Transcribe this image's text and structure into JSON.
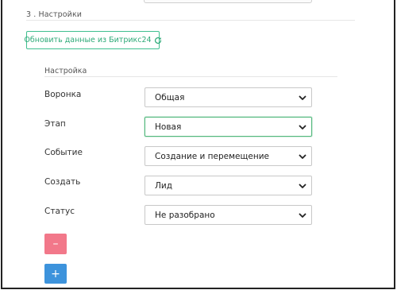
{
  "section": {
    "title": "3 . Настройки",
    "refresh_button": {
      "label": "Обновить данные из Битрикс24",
      "icon": "refresh-icon"
    }
  },
  "group": {
    "title": "Настройка"
  },
  "fields": [
    {
      "label": "Воронка",
      "value": "Общая",
      "focused": false
    },
    {
      "label": "Этап",
      "value": "Новая",
      "focused": true
    },
    {
      "label": "Событие",
      "value": "Создание и перемещение",
      "focused": false
    },
    {
      "label": "Создать",
      "value": "Лид",
      "focused": false
    },
    {
      "label": "Статус",
      "value": "Не разобрано",
      "focused": false
    }
  ],
  "actions": {
    "remove_label": "–",
    "add_label": "+"
  },
  "colors": {
    "accent_green": "#2eaa78",
    "remove_red": "#f2788a",
    "add_blue": "#3d93dc"
  }
}
